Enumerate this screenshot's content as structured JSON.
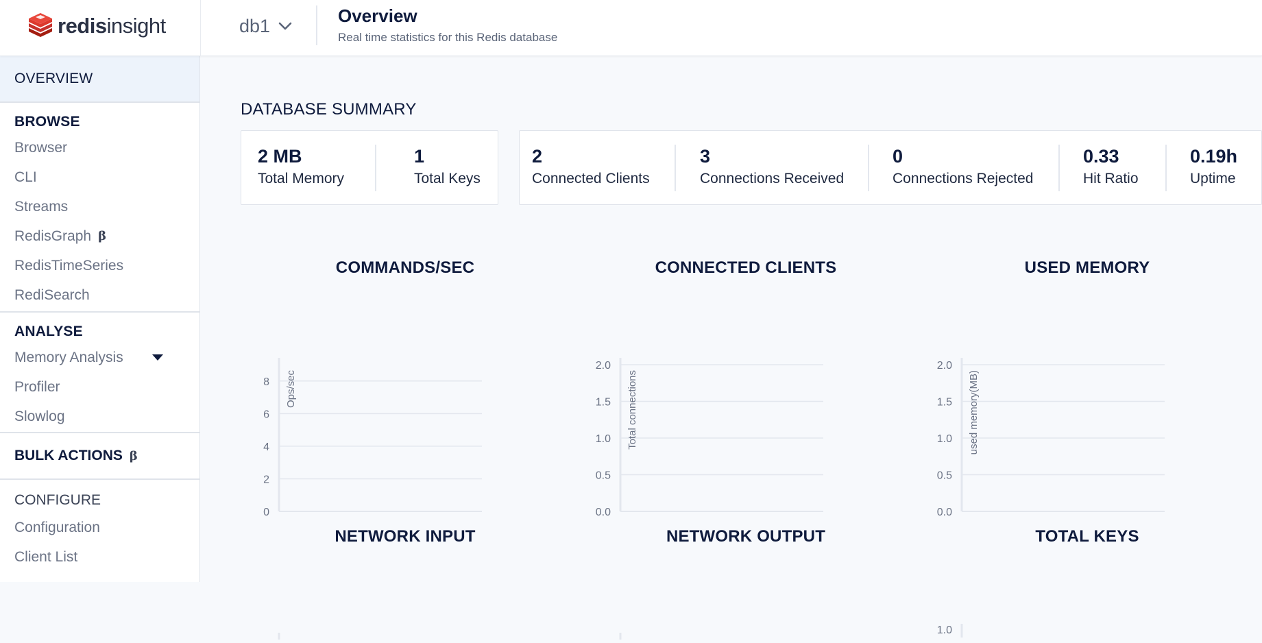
{
  "header": {
    "logo": {
      "bold": "redis",
      "light": "insight"
    },
    "db_name": "db1",
    "title": "Overview",
    "subtitle": "Real time statistics for this Redis database"
  },
  "sidebar": {
    "active": "OVERVIEW",
    "browse": {
      "heading": "BROWSE",
      "items": [
        "Browser",
        "CLI",
        "Streams",
        "RedisGraph",
        "RedisTimeSeries",
        "RediSearch"
      ],
      "beta_symbol": "β"
    },
    "analyse": {
      "heading": "ANALYSE",
      "items": [
        "Memory Analysis",
        "Profiler",
        "Slowlog"
      ]
    },
    "bulk_actions": {
      "label": "BULK ACTIONS",
      "beta_symbol": "β"
    },
    "configure": {
      "heading": "CONFIGURE",
      "items": [
        "Configuration",
        "Client List"
      ]
    }
  },
  "summary": {
    "title": "DATABASE SUMMARY",
    "card1": [
      {
        "value": "2 MB",
        "label": "Total Memory"
      },
      {
        "value": "1",
        "label": "Total Keys"
      }
    ],
    "card2": [
      {
        "value": "2",
        "label": "Connected Clients"
      },
      {
        "value": "3",
        "label": "Connections Received"
      },
      {
        "value": "0",
        "label": "Connections Rejected"
      },
      {
        "value": "0.33",
        "label": "Hit Ratio"
      },
      {
        "value": "0.19h",
        "label": "Uptime"
      }
    ]
  },
  "chart_data": [
    {
      "type": "line",
      "title": "COMMANDS/SEC",
      "ylabel": "Ops/sec",
      "xlabel": "",
      "yticks": [
        "0",
        "2",
        "4",
        "6",
        "8"
      ],
      "ylim": [
        0,
        9
      ],
      "series": []
    },
    {
      "type": "line",
      "title": "CONNECTED CLIENTS",
      "ylabel": "Total connections",
      "xlabel": "",
      "yticks": [
        "0.0",
        "0.5",
        "1.0",
        "1.5",
        "2.0"
      ],
      "ylim": [
        0,
        2
      ],
      "series": []
    },
    {
      "type": "line",
      "title": "USED MEMORY",
      "ylabel": "used memory(MB)",
      "xlabel": "",
      "yticks": [
        "0.0",
        "0.5",
        "1.0",
        "1.5",
        "2.0"
      ],
      "ylim": [
        0,
        2
      ],
      "series": []
    },
    {
      "type": "line",
      "title": "NETWORK INPUT",
      "ylabel": "",
      "xlabel": "",
      "yticks": [],
      "series": []
    },
    {
      "type": "line",
      "title": "NETWORK OUTPUT",
      "ylabel": "",
      "xlabel": "",
      "yticks": [],
      "series": []
    },
    {
      "type": "line",
      "title": "TOTAL KEYS",
      "ylabel": "",
      "xlabel": "",
      "yticks": [
        "1.0"
      ],
      "ylim": [
        0,
        1
      ],
      "series": []
    }
  ],
  "colors": {
    "brand": "#dc382c",
    "text": "#0f1b3d",
    "muted": "#6b7385",
    "grid": "#e3e7ee",
    "active_bg": "#edf3fb"
  }
}
